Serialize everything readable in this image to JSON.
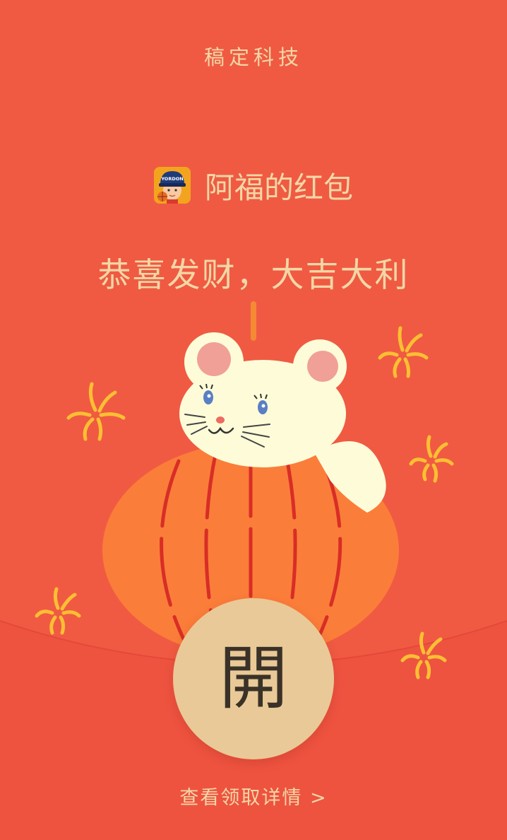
{
  "brand": {
    "title": "稿定科技"
  },
  "envelope": {
    "sender_name": "阿福的红包",
    "avatar_badge": "YORDON",
    "greeting": "恭喜发财，大吉大利"
  },
  "open_button": {
    "label": "開"
  },
  "details_link": {
    "label": "查看领取详情 >"
  },
  "colors": {
    "background": "#f05a42",
    "lower_panel": "#ee5340",
    "text_gold": "#f3d7a6",
    "button_gold": "#e9c997",
    "lantern_orange": "#fb7d3a",
    "lantern_ribs": "#d82e26",
    "mouse_cream": "#fefcd8",
    "firework_yellow": "#fbbf33"
  },
  "icons": [
    "avatar-image",
    "lantern-illustration",
    "mouse-illustration",
    "firework-icon"
  ]
}
